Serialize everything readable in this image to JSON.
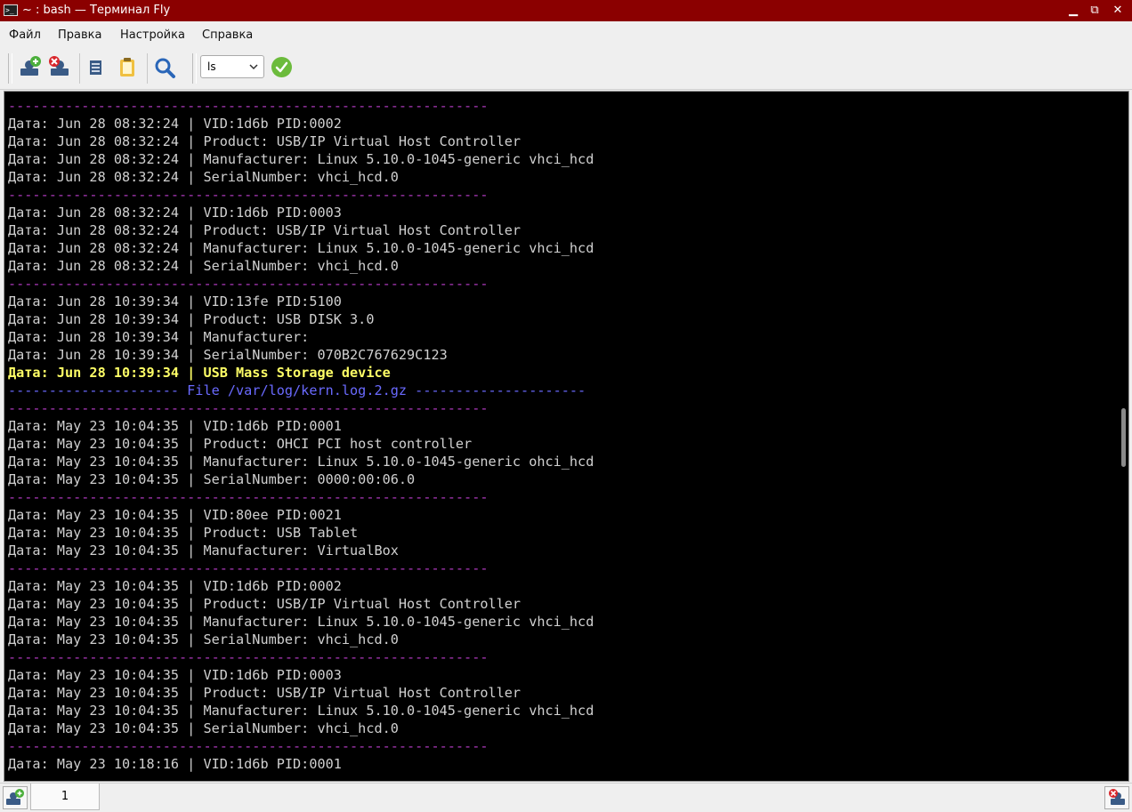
{
  "window": {
    "title": "~ : bash — Терминал Fly",
    "minimize": "▁",
    "maximize": "⧉",
    "close": "✕"
  },
  "menu": [
    "Файл",
    "Правка",
    "Настройка",
    "Справка"
  ],
  "toolbar": {
    "command_value": "ls",
    "icons": [
      "new-session-icon",
      "close-session-icon",
      "copy-icon",
      "paste-icon",
      "search-icon",
      "run-command-icon"
    ]
  },
  "terminal": {
    "lines": [
      {
        "text": "-----------------------------------------------------------",
        "style": "sep"
      },
      {
        "text": "Дата: Jun 28 08:32:24 | VID:1d6b PID:0002",
        "style": "normal"
      },
      {
        "text": "Дата: Jun 28 08:32:24 | Product: USB/IP Virtual Host Controller",
        "style": "normal"
      },
      {
        "text": "Дата: Jun 28 08:32:24 | Manufacturer: Linux 5.10.0-1045-generic vhci_hcd",
        "style": "normal"
      },
      {
        "text": "Дата: Jun 28 08:32:24 | SerialNumber: vhci_hcd.0",
        "style": "normal"
      },
      {
        "text": "-----------------------------------------------------------",
        "style": "sep"
      },
      {
        "text": "Дата: Jun 28 08:32:24 | VID:1d6b PID:0003",
        "style": "normal"
      },
      {
        "text": "Дата: Jun 28 08:32:24 | Product: USB/IP Virtual Host Controller",
        "style": "normal"
      },
      {
        "text": "Дата: Jun 28 08:32:24 | Manufacturer: Linux 5.10.0-1045-generic vhci_hcd",
        "style": "normal"
      },
      {
        "text": "Дата: Jun 28 08:32:24 | SerialNumber: vhci_hcd.0",
        "style": "normal"
      },
      {
        "text": "-----------------------------------------------------------",
        "style": "sep"
      },
      {
        "text": "Дата: Jun 28 10:39:34 | VID:13fe PID:5100",
        "style": "normal"
      },
      {
        "text": "Дата: Jun 28 10:39:34 | Product: USB DISK 3.0",
        "style": "normal"
      },
      {
        "text": "Дата: Jun 28 10:39:34 | Manufacturer:",
        "style": "normal"
      },
      {
        "text": "Дата: Jun 28 10:39:34 | SerialNumber: 070B2C767629C123",
        "style": "normal"
      },
      {
        "text": "Дата: Jun 28 10:39:34 | USB Mass Storage device",
        "style": "highlight"
      },
      {
        "text": "--------------------- File /var/log/kern.log.2.gz ---------------------",
        "style": "file"
      },
      {
        "text": "-----------------------------------------------------------",
        "style": "sep"
      },
      {
        "text": "Дата: May 23 10:04:35 | VID:1d6b PID:0001",
        "style": "normal"
      },
      {
        "text": "Дата: May 23 10:04:35 | Product: OHCI PCI host controller",
        "style": "normal"
      },
      {
        "text": "Дата: May 23 10:04:35 | Manufacturer: Linux 5.10.0-1045-generic ohci_hcd",
        "style": "normal"
      },
      {
        "text": "Дата: May 23 10:04:35 | SerialNumber: 0000:00:06.0",
        "style": "normal"
      },
      {
        "text": "-----------------------------------------------------------",
        "style": "sep"
      },
      {
        "text": "Дата: May 23 10:04:35 | VID:80ee PID:0021",
        "style": "normal"
      },
      {
        "text": "Дата: May 23 10:04:35 | Product: USB Tablet",
        "style": "normal"
      },
      {
        "text": "Дата: May 23 10:04:35 | Manufacturer: VirtualBox",
        "style": "normal"
      },
      {
        "text": "-----------------------------------------------------------",
        "style": "sep"
      },
      {
        "text": "Дата: May 23 10:04:35 | VID:1d6b PID:0002",
        "style": "normal"
      },
      {
        "text": "Дата: May 23 10:04:35 | Product: USB/IP Virtual Host Controller",
        "style": "normal"
      },
      {
        "text": "Дата: May 23 10:04:35 | Manufacturer: Linux 5.10.0-1045-generic vhci_hcd",
        "style": "normal"
      },
      {
        "text": "Дата: May 23 10:04:35 | SerialNumber: vhci_hcd.0",
        "style": "normal"
      },
      {
        "text": "-----------------------------------------------------------",
        "style": "sep"
      },
      {
        "text": "Дата: May 23 10:04:35 | VID:1d6b PID:0003",
        "style": "normal"
      },
      {
        "text": "Дата: May 23 10:04:35 | Product: USB/IP Virtual Host Controller",
        "style": "normal"
      },
      {
        "text": "Дата: May 23 10:04:35 | Manufacturer: Linux 5.10.0-1045-generic vhci_hcd",
        "style": "normal"
      },
      {
        "text": "Дата: May 23 10:04:35 | SerialNumber: vhci_hcd.0",
        "style": "normal"
      },
      {
        "text": "-----------------------------------------------------------",
        "style": "sep"
      },
      {
        "text": "Дата: May 23 10:18:16 | VID:1d6b PID:0001",
        "style": "normal"
      }
    ]
  },
  "tabs": [
    {
      "label": "1"
    }
  ],
  "colors": {
    "titlebar": "#8b0000",
    "terminal_bg": "#000000",
    "terminal_fg": "#d0d0d0",
    "separator": "#b03ac0",
    "highlight": "#ffff66",
    "file_header": "#6a6aff"
  }
}
